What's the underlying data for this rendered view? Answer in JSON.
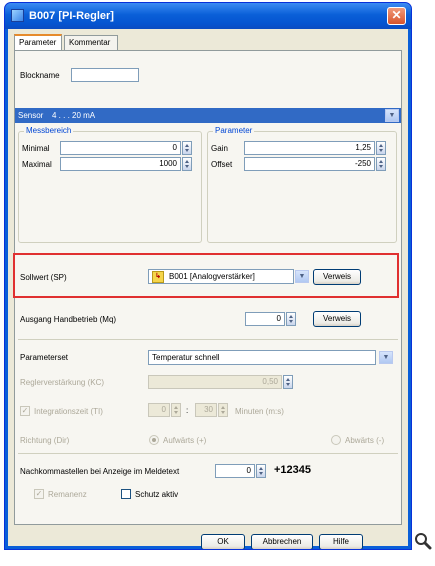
{
  "window": {
    "title": "B007 [PI-Regler]"
  },
  "tabs": [
    "Parameter",
    "Kommentar"
  ],
  "blockname": {
    "label": "Blockname",
    "value": ""
  },
  "sensor": {
    "label": "Sensor",
    "value": "4 . . . 20 mA"
  },
  "messbereich": {
    "title": "Messbereich",
    "min_label": "Minimal",
    "min_value": "0",
    "max_label": "Maximal",
    "max_value": "1000"
  },
  "parameter_group": {
    "title": "Parameter",
    "gain_label": "Gain",
    "gain_value": "1,25",
    "offset_label": "Offset",
    "offset_value": "-250"
  },
  "sollwert": {
    "label": "Sollwert (SP)",
    "value": "B001 [Analogverstärker]",
    "button": "Verweis"
  },
  "ausgang": {
    "label": "Ausgang Handbetrieb (Mq)",
    "value": "0",
    "button": "Verweis"
  },
  "parameterset": {
    "label": "Parameterset",
    "value": "Temperatur schnell"
  },
  "reglerverstaerkung": {
    "label": "Reglerverstärkung (KC)",
    "value": "0,50"
  },
  "integrationszeit": {
    "label": "Integrationszeit (TI)",
    "minutes": "0",
    "separator": ":",
    "seconds": "30",
    "unit": "Minuten (m:s)"
  },
  "richtung": {
    "label": "Richtung (Dir)",
    "option_up": "Aufwärts (+)",
    "option_down": "Abwärts (-)"
  },
  "nachkomma": {
    "label": "Nachkommastellen bei Anzeige im Meldetext",
    "value": "0",
    "preview": "+12345"
  },
  "remanenz": {
    "label": "Remanenz"
  },
  "schutz": {
    "label": "Schutz aktiv"
  },
  "buttons": {
    "ok": "OK",
    "cancel": "Abbrechen",
    "help": "Hilfe"
  },
  "icons": {
    "window_icon": "window-icon",
    "close": "close-icon",
    "magnifier": "magnifier-icon",
    "reference": "block-reference-icon"
  }
}
